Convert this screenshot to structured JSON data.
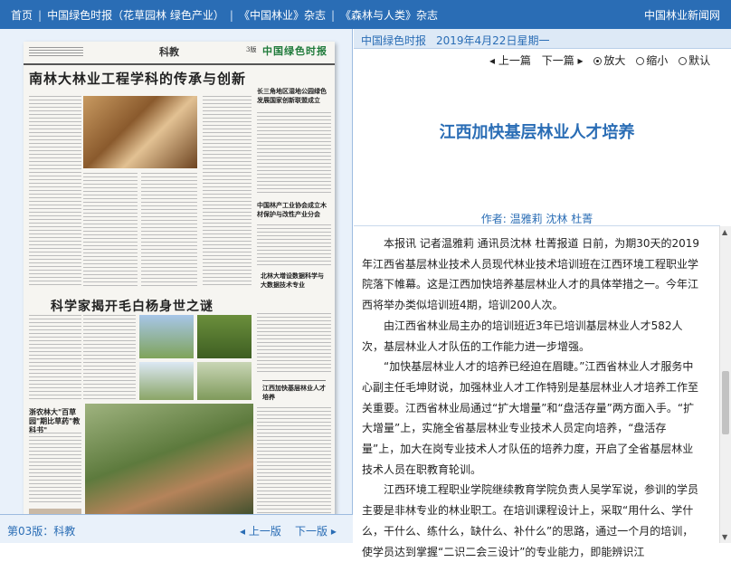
{
  "topbar": {
    "nav": [
      "首页",
      "中国绿色时报（花草园林 绿色产业）",
      "《中国林业》杂志",
      "《森林与人类》杂志"
    ],
    "site": "中国林业新闻网"
  },
  "paper": {
    "section": "科教",
    "page_no": "3版",
    "logo": "中国绿色时报",
    "headline_1": "南林大林业工程学科的传承与创新",
    "headline_2": "科学家揭开毛白杨身世之谜",
    "side_1": "长三角地区湿地公园绿色发展国家创新联盟成立",
    "side_2": "中国林产工业协会成立木材保护与改性产业分会",
    "side_3": "北林大增设数据科学与大数据技术专业",
    "side_4": "江西加快基层林业人才培养",
    "side_5": "浙农林大\"百草园\"期比草药\"教科书\""
  },
  "left_footer": {
    "edition": "第03版：科教",
    "prev": "上一版",
    "next": "下一版"
  },
  "meta": {
    "paper_name": "中国绿色时报",
    "date": "2019年4月22日星期一"
  },
  "controls": {
    "prev": "上一篇",
    "next": "下一篇",
    "zoom_in": "放大",
    "zoom_out": "缩小",
    "default": "默认"
  },
  "article": {
    "title": "江西加快基层林业人才培养",
    "author": "作者: 温雅莉 沈林 杜菁",
    "paragraphs": [
      "本报讯 记者温雅莉 通讯员沈林 杜菁报道 日前，为期30天的2019年江西省基层林业技术人员现代林业技术培训班在江西环境工程职业学院落下帷幕。这是江西加快培养基层林业人才的具体举措之一。今年江西将举办类似培训班4期，培训200人次。",
      "由江西省林业局主办的培训班近3年已培训基层林业人才582人次，基层林业人才队伍的工作能力进一步增强。",
      "“加快基层林业人才的培养已经迫在眉睫。”江西省林业人才服务中心副主任毛坤财说，加强林业人才工作特别是基层林业人才培养工作至关重要。江西省林业局通过“扩大增量”和“盘活存量”两方面入手。“扩大增量”上，实施全省基层林业专业技术人员定向培养，“盘活存量”上，加大在岗专业技术人才队伍的培养力度，开启了全省基层林业技术人员在职教育轮训。",
      "江西环境工程职业学院继续教育学院负责人吴学军说，参训的学员主要是非林专业的林业职工。在培训课程设计上，采取“用什么、学什么，干什么、练什么，缺什么、补什么”的思路，通过一个月的培训，使学员达到掌握“二识二会三设计”的专业能力，即能辨识江"
    ]
  }
}
